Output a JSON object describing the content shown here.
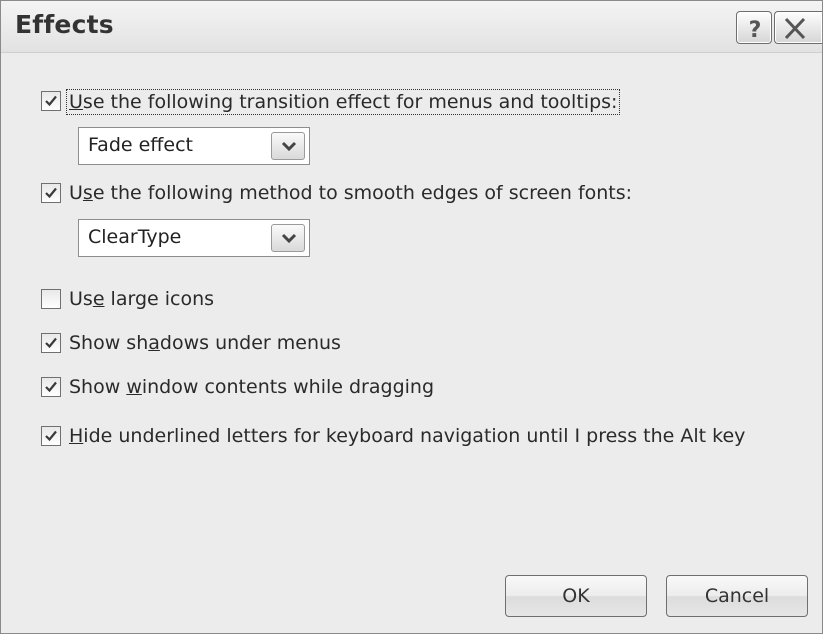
{
  "window": {
    "title": "Effects",
    "help_icon": "question-mark-icon",
    "close_icon": "close-x-icon"
  },
  "options": [
    {
      "checked": true,
      "label_pre": "",
      "label_mnemonic": "U",
      "label_post": "se the following transition effect for menus and tooltips:"
    },
    {
      "checked": true,
      "label_pre": "U",
      "label_mnemonic": "s",
      "label_post": "e the following method to smooth edges of screen fonts:"
    },
    {
      "checked": false,
      "label_pre": "Us",
      "label_mnemonic": "e",
      "label_post": " large icons"
    },
    {
      "checked": true,
      "label_pre": "Show sh",
      "label_mnemonic": "a",
      "label_post": "dows under menus"
    },
    {
      "checked": true,
      "label_pre": "Show ",
      "label_mnemonic": "w",
      "label_post": "indow contents while dragging"
    },
    {
      "checked": true,
      "label_pre": "",
      "label_mnemonic": "H",
      "label_post": "ide underlined letters for keyboard navigation until I press the Alt key"
    }
  ],
  "transition_select": {
    "value": "Fade effect"
  },
  "smoothing_select": {
    "value": "ClearType"
  },
  "buttons": {
    "ok": "OK",
    "cancel": "Cancel"
  },
  "colors": {
    "dialog_background": "#ececec",
    "checkmark": "#3a3a3a"
  }
}
